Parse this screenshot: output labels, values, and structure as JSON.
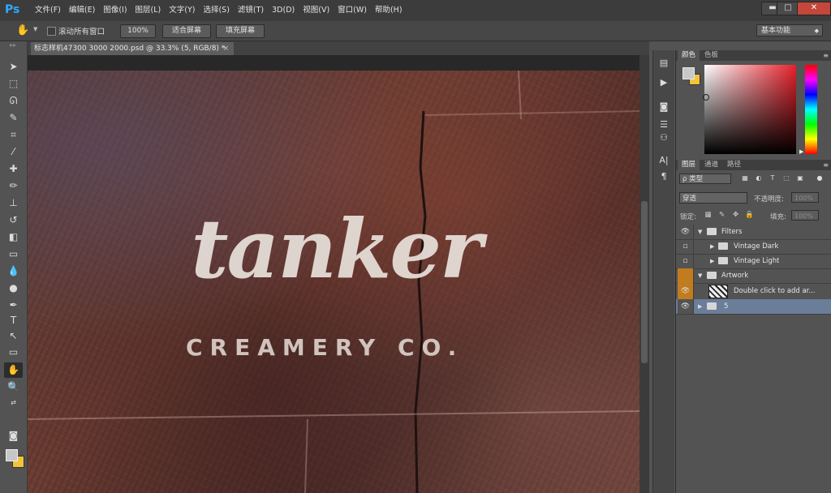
{
  "app": {
    "logo": "Ps"
  },
  "menu": [
    "文件(F)",
    "编辑(E)",
    "图像(I)",
    "图层(L)",
    "文字(Y)",
    "选择(S)",
    "滤镜(T)",
    "3D(D)",
    "视图(V)",
    "窗口(W)",
    "帮助(H)"
  ],
  "window_controls": {
    "minimize": "▬",
    "maximize": "□",
    "close": "✕"
  },
  "options": {
    "scroll_all_label": "滚动所有窗口",
    "zoom_button": "100%",
    "fit_screen_button": "适合屏幕",
    "fill_screen_button": "填充屏幕",
    "workspace": "基本功能"
  },
  "document": {
    "tab_title": "标志样机47300 3000 2000.psd @ 33.3% (5, RGB/8) *",
    "close": "×"
  },
  "artwork": {
    "main_text": "tanker",
    "sub_text": "CREAMERY CO."
  },
  "color_panel": {
    "tabs": [
      "颜色",
      "色板"
    ],
    "foreground": "#c8c8c8",
    "background": "#f2c33a"
  },
  "layers_panel": {
    "tabs": [
      "图层",
      "通道",
      "路径"
    ],
    "filter_kind": "ρ 类型",
    "blend_mode": "穿透",
    "opacity_label": "不透明度:",
    "opacity_value": "100%",
    "lock_label": "锁定:",
    "fill_label": "填充:",
    "fill_value": "100%",
    "layers": [
      {
        "name": "Filters",
        "visible": true,
        "type": "group",
        "expanded": true,
        "indent": 0
      },
      {
        "name": "Vintage Dark",
        "visible": false,
        "type": "group",
        "expanded": false,
        "indent": 1
      },
      {
        "name": "Vintage Light",
        "visible": false,
        "type": "group",
        "expanded": false,
        "indent": 1
      },
      {
        "name": "Artwork",
        "visible": false,
        "type": "group",
        "expanded": true,
        "indent": 0,
        "highlight": "orange"
      },
      {
        "name": "Double click to add ar...",
        "visible": true,
        "type": "smart-object",
        "indent": 1,
        "highlight": "orange"
      },
      {
        "name": "5",
        "visible": true,
        "type": "group",
        "expanded": false,
        "indent": 0,
        "selected": true
      }
    ]
  },
  "colors": {
    "accent_orange": "#c07c1e",
    "selection_blue": "#6a7d99"
  }
}
